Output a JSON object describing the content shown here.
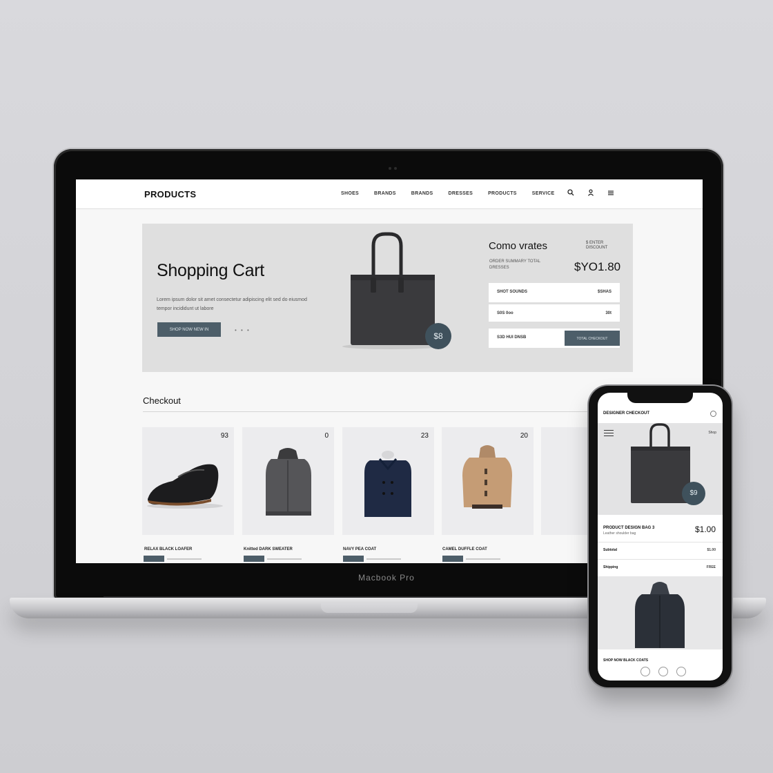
{
  "desktop": {
    "logo": "PRODUCTS",
    "nav": [
      "SHOES",
      "BRANDS",
      "BRANDS",
      "DRESSES",
      "PRODUCTS",
      "SERVICE"
    ],
    "hero": {
      "title": "Shopping Cart",
      "description": "Lorem ipsum dolor sit amet consectetur adipiscing elit sed do eiusmod tempor incididunt ut labore",
      "button_label": "SHOP NOW NEW IN",
      "dots": "• • •",
      "badge": "$8"
    },
    "summary": {
      "title": "Como vrates",
      "tag": "$ ENTER DISCOUNT",
      "subtitle": "ORDER SUMMARY TOTAL",
      "subtitle2": "DRESSES",
      "total": "$YO1.80",
      "rows": [
        {
          "label": "SHOT SOUNDS",
          "value": "$SHAS"
        },
        {
          "label": "S0S 0oo",
          "value": "30t"
        }
      ],
      "checkout_row_label": "S3D HUI DNSB",
      "checkout_button": "TOTAL CHECKOUT"
    },
    "section_title": "Checkout",
    "products": [
      {
        "price": "93",
        "name": "RELAX BLACK LOAFER"
      },
      {
        "price": "0",
        "name": "Knitted DARK SWEATER"
      },
      {
        "price": "23",
        "name": "NAVY PEA COAT"
      },
      {
        "price": "20",
        "name": "CAMEL DUFFLE COAT"
      }
    ],
    "laptop_brand": "Macbook Pro"
  },
  "mobile": {
    "title": "DESIGNER CHECKOUT",
    "hero_link": "Shop",
    "hero_badge": "$9",
    "item_name": "PRODUCT DESIGN BAG 3",
    "item_sub": "Leather shoulder bag",
    "item_price": "$1.00",
    "rows": [
      {
        "label": "Subtotal",
        "value": "$1.00"
      },
      {
        "label": "Shipping",
        "value": "FREE"
      }
    ],
    "footer": "SHOP NOW BLACK COATS"
  },
  "colors": {
    "accent": "#4d5e69",
    "badge": "#3f515c",
    "hero_bg": "#dfdfdf",
    "card_bg": "#ececee"
  }
}
